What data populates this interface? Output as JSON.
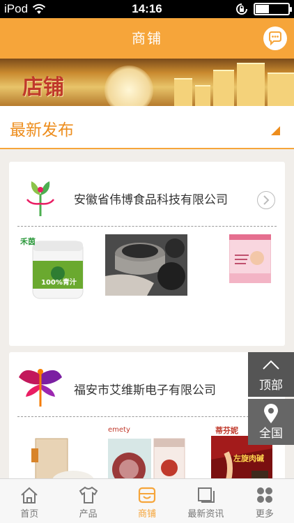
{
  "status_bar": {
    "carrier": "iPod",
    "time": "14:16"
  },
  "nav": {
    "title": "商铺"
  },
  "banner": {
    "text": "店铺"
  },
  "section": {
    "title": "最新发布"
  },
  "cards": [
    {
      "company": "安徽省伟博食品科技有限公司"
    },
    {
      "company": "福安市艾维斯电子有限公司"
    }
  ],
  "products": {
    "p1_brand": "禾茵",
    "p1_label": "100%青汁",
    "p4_brand": "emety",
    "p5_brand": "蒂芬妮",
    "p6_label": "左旋肉碱"
  },
  "float": {
    "top_label": "顶部",
    "all_label": "全国"
  },
  "tabs": [
    {
      "label": "首页",
      "icon": "home-icon"
    },
    {
      "label": "产品",
      "icon": "shirt-icon"
    },
    {
      "label": "商铺",
      "icon": "shop-icon",
      "active": true
    },
    {
      "label": "最新资讯",
      "icon": "news-icon"
    },
    {
      "label": "更多",
      "icon": "more-icon"
    }
  ],
  "colors": {
    "accent": "#f6a53a",
    "section_title": "#ed8d1d"
  }
}
